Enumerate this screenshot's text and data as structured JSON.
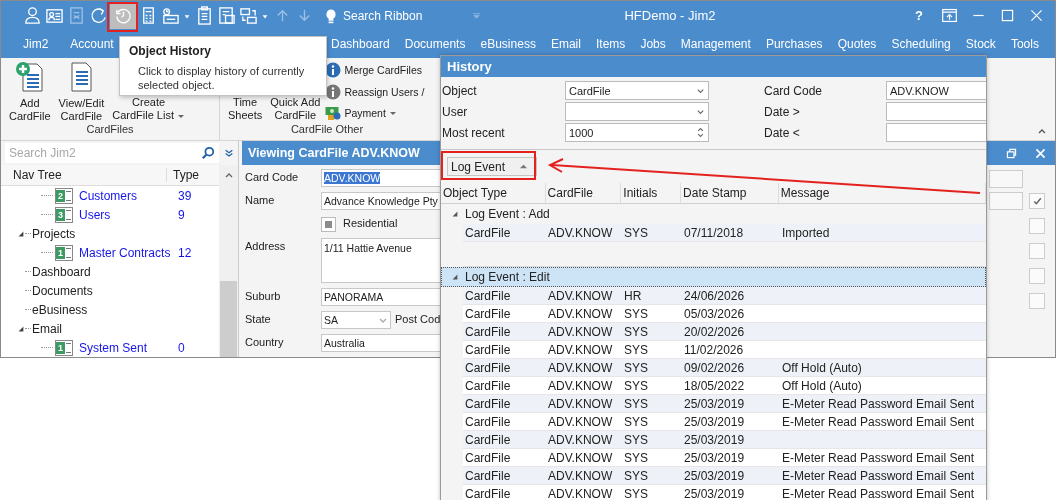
{
  "window": {
    "title": "HFDemo - Jim2",
    "help_label": "?"
  },
  "quick_access": [
    {
      "kind": "person",
      "disabled": false,
      "hovered": false
    },
    {
      "kind": "contact",
      "disabled": false,
      "hovered": false
    },
    {
      "kind": "document",
      "disabled": true,
      "hovered": false
    },
    {
      "kind": "refresh",
      "disabled": false,
      "hovered": false
    },
    {
      "kind": "history",
      "disabled": false,
      "hovered": true
    },
    {
      "kind": "calculator",
      "disabled": false,
      "hovered": false
    },
    {
      "kind": "schedule",
      "disabled": false,
      "hovered": false
    },
    {
      "kind": "caret",
      "disabled": false,
      "hovered": false
    },
    {
      "kind": "clipboard",
      "disabled": false,
      "hovered": false
    },
    {
      "kind": "form",
      "disabled": false,
      "hovered": false
    },
    {
      "kind": "windows",
      "disabled": false,
      "hovered": false
    },
    {
      "kind": "caret",
      "disabled": false,
      "hovered": false
    },
    {
      "kind": "up",
      "disabled": true,
      "hovered": false
    },
    {
      "kind": "down",
      "disabled": true,
      "hovered": false
    }
  ],
  "search_ribbon": {
    "placeholder": "Search Ribbon"
  },
  "menu_tabs": [
    "Jim2",
    "Account",
    "Dashboard",
    "Documents",
    "eBusiness",
    "Email",
    "Items",
    "Jobs",
    "Management",
    "Purchases",
    "Quotes",
    "Scheduling",
    "Stock",
    "Tools"
  ],
  "tooltip": {
    "title": "Object History",
    "text": "Click to display history of currently selected object."
  },
  "ribbon": {
    "groups": [
      {
        "label": "CardFiles",
        "large": [
          {
            "kind": "add",
            "lines": [
              "Add",
              "CardFile"
            ],
            "dropdown": false
          },
          {
            "kind": "edit",
            "lines": [
              "View/Edit",
              "CardFile"
            ],
            "dropdown": false
          },
          {
            "kind": "covered",
            "lines": [
              "Create",
              "CardFile List"
            ],
            "dropdown": true
          }
        ]
      },
      {
        "label": "CardFile Other",
        "large": [
          {
            "kind": "covered",
            "lines": [
              "Time",
              "Sheets"
            ],
            "dropdown": false
          },
          {
            "kind": "covered",
            "lines": [
              "Quick Add",
              "CardFile"
            ],
            "dropdown": false
          }
        ],
        "small": [
          {
            "kind": "info",
            "label": "Merge CardFiles",
            "dropdown": false
          },
          {
            "kind": "info-grey",
            "label": "Reassign Users /",
            "dropdown": false
          },
          {
            "kind": "payment",
            "label": "Payment",
            "dropdown": true
          }
        ]
      }
    ]
  },
  "nav": {
    "search": {
      "placeholder": "Search Jim2"
    },
    "columns": [
      "Nav Tree",
      "Type"
    ],
    "items": [
      {
        "kind": "continued",
        "children": [
          {
            "kind": "list",
            "label": "Customers",
            "badge": "2",
            "count": "39"
          },
          {
            "kind": "list",
            "label": "Users",
            "badge": "3",
            "count": "9"
          }
        ]
      },
      {
        "kind": "group",
        "label": "Projects",
        "expanded": true,
        "children": [
          {
            "kind": "list",
            "label": "Master Contracts",
            "badge": "1",
            "count": "12"
          }
        ]
      },
      {
        "kind": "section",
        "label": "Dashboard"
      },
      {
        "kind": "section",
        "label": "Documents"
      },
      {
        "kind": "section",
        "label": "eBusiness"
      },
      {
        "kind": "group",
        "label": "Email",
        "expanded": true,
        "children": [
          {
            "kind": "list",
            "label": "System Sent",
            "badge": "1",
            "count": "0"
          }
        ]
      }
    ]
  },
  "form": {
    "title": "Viewing CardFile ADV.KNOW",
    "fields": [
      {
        "kind": "text",
        "label": "Card Code",
        "value": "ADV.KNOW",
        "text_selected": true
      },
      {
        "kind": "text",
        "label": "Name",
        "value": "Advance Knowledge Pty",
        "text_selected": false
      },
      {
        "kind": "checkbox",
        "label": "Residential",
        "indeterminate": true
      },
      {
        "kind": "multiline",
        "label": "Address",
        "value": "1/11 Hattie Avenue",
        "text_selected": false
      },
      {
        "kind": "text",
        "label": "Suburb",
        "value": "PANORAMA",
        "text_selected": false
      },
      {
        "kind": "select",
        "label": "State",
        "value": "SA",
        "text_selected": false,
        "extra_label": "Post Cod"
      },
      {
        "kind": "text",
        "label": "Country",
        "value": "Australia",
        "text_selected": false
      }
    ],
    "side_checkboxes": [
      {
        "checked": true
      },
      {
        "checked": false
      },
      {
        "checked": false
      },
      {
        "checked": false
      },
      {
        "checked": false
      }
    ]
  },
  "history": {
    "title": "History",
    "filters": [
      {
        "kind": "select",
        "label": "Object",
        "value": "CardFile"
      },
      {
        "kind": "text",
        "label": "Card Code",
        "value": "ADV.KNOW"
      },
      {
        "kind": "select",
        "label": "User"
      },
      {
        "kind": "text",
        "label": "Date >"
      },
      {
        "kind": "spin",
        "label": "Most recent",
        "value": "1000"
      },
      {
        "kind": "text",
        "label": "Date <"
      }
    ],
    "group_by": {
      "label": "Log Event",
      "sort_ascending": true
    },
    "columns": [
      "Object Type",
      "CardFile",
      "Initials",
      "Date Stamp",
      "Message"
    ],
    "groups": [
      {
        "title": "Log Event : Add",
        "expanded": true,
        "selected": false,
        "rows": [
          {
            "object_type": "CardFile",
            "cardfile": "ADV.KNOW",
            "initials": "SYS",
            "date_stamp": "07/11/2018",
            "message": "Imported"
          }
        ]
      },
      {
        "title": "Log Event : Edit",
        "expanded": true,
        "selected": true,
        "rows": [
          {
            "object_type": "CardFile",
            "cardfile": "ADV.KNOW",
            "initials": "HR",
            "date_stamp": "24/06/2026"
          },
          {
            "object_type": "CardFile",
            "cardfile": "ADV.KNOW",
            "initials": "SYS",
            "date_stamp": "05/03/2026"
          },
          {
            "object_type": "CardFile",
            "cardfile": "ADV.KNOW",
            "initials": "SYS",
            "date_stamp": "20/02/2026"
          },
          {
            "object_type": "CardFile",
            "cardfile": "ADV.KNOW",
            "initials": "SYS",
            "date_stamp": "11/02/2026"
          },
          {
            "object_type": "CardFile",
            "cardfile": "ADV.KNOW",
            "initials": "SYS",
            "date_stamp": "09/02/2026",
            "message": "Off Hold (Auto)"
          },
          {
            "object_type": "CardFile",
            "cardfile": "ADV.KNOW",
            "initials": "SYS",
            "date_stamp": "18/05/2022",
            "message": "Off Hold (Auto)"
          },
          {
            "object_type": "CardFile",
            "cardfile": "ADV.KNOW",
            "initials": "SYS",
            "date_stamp": "25/03/2019",
            "message": "E-Meter Read Password Email Sent"
          },
          {
            "object_type": "CardFile",
            "cardfile": "ADV.KNOW",
            "initials": "SYS",
            "date_stamp": "25/03/2019",
            "message": "E-Meter Read Password Email Sent"
          },
          {
            "object_type": "CardFile",
            "cardfile": "ADV.KNOW",
            "initials": "SYS",
            "date_stamp": "25/03/2019"
          },
          {
            "object_type": "CardFile",
            "cardfile": "ADV.KNOW",
            "initials": "SYS",
            "date_stamp": "25/03/2019",
            "message": "E-Meter Read Password Email Sent"
          },
          {
            "object_type": "CardFile",
            "cardfile": "ADV.KNOW",
            "initials": "SYS",
            "date_stamp": "25/03/2019",
            "message": "E-Meter Read Password Email Sent"
          },
          {
            "object_type": "CardFile",
            "cardfile": "ADV.KNOW",
            "initials": "SYS",
            "date_stamp": "25/03/2019",
            "message": "E-Meter Read Password Email Sent"
          }
        ]
      }
    ]
  }
}
